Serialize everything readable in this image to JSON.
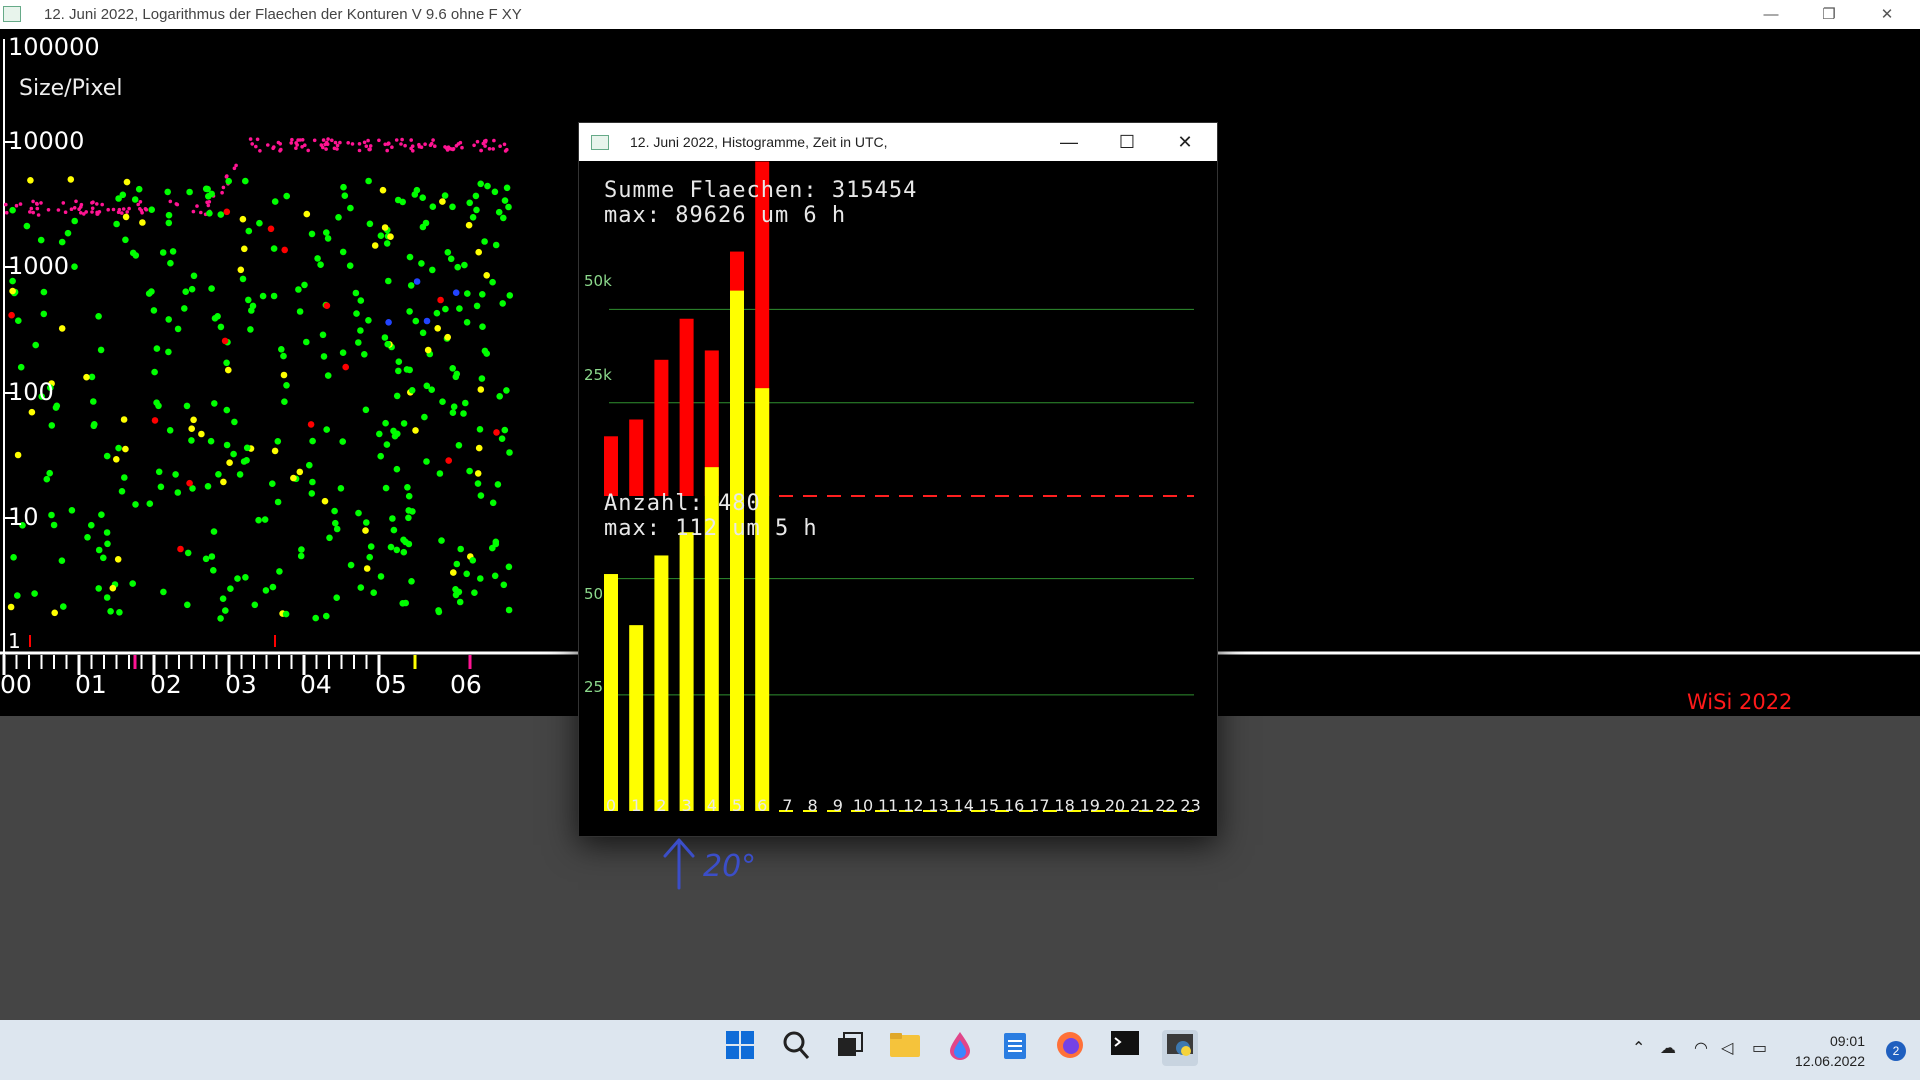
{
  "main_window": {
    "title": "12. Juni 2022, Logarithmus der Flaechen der Konturen  V 9.6 ohne F XY",
    "controls": [
      "—",
      "❐",
      "✕"
    ]
  },
  "scatter_plot": {
    "y_axis_labels": [
      "100000",
      "10000",
      "1000",
      "100",
      "10",
      "1"
    ],
    "y_axis_title": "Size/Pixel",
    "x_hour_labels": [
      "00",
      "01",
      "02",
      "03",
      "04",
      "05",
      "06"
    ],
    "credit": "WiSi 2022",
    "colors": {
      "green": "#00ff00",
      "yellow": "#ffff00",
      "red": "#ff0000",
      "magenta": "#ff1493",
      "blue": "#2244ff"
    }
  },
  "histogram_window": {
    "title": "12. Juni 2022, Histogramme, Zeit in UTC,",
    "controls": [
      "—",
      "☐",
      "✕"
    ],
    "area_sum_line": "Summe Flaechen: 315454",
    "area_max_line": "max: 89626 um 6 h",
    "count_line": "Anzahl: 480",
    "count_max_line": "max: 112 um 5 h",
    "grid_labels_area": [
      "50k",
      "25k"
    ],
    "grid_labels_count": [
      "50",
      "25"
    ],
    "hours": [
      "0",
      "1",
      "2",
      "3",
      "4",
      "5",
      "6",
      "7",
      "8",
      "9",
      "10",
      "11",
      "12",
      "13",
      "14",
      "15",
      "16",
      "17",
      "18",
      "19",
      "20",
      "21",
      "22",
      "23"
    ]
  },
  "chart_data": [
    {
      "type": "bar",
      "title": "Summe Flaechen: 315454",
      "categories": [
        "0",
        "1",
        "2",
        "3",
        "4",
        "5",
        "6",
        "7",
        "8",
        "9",
        "10",
        "11",
        "12",
        "13",
        "14",
        "15",
        "16",
        "17",
        "18",
        "19",
        "20",
        "21",
        "22",
        "23"
      ],
      "values": [
        16000,
        20500,
        36500,
        47500,
        39000,
        65500,
        89626,
        0,
        0,
        0,
        0,
        0,
        0,
        0,
        0,
        0,
        0,
        0,
        0,
        0,
        0,
        0,
        0,
        0
      ],
      "ylim": [
        0,
        82000
      ],
      "color": "#ff0000"
    },
    {
      "type": "bar",
      "title": "Anzahl: 480",
      "categories": [
        "0",
        "1",
        "2",
        "3",
        "4",
        "5",
        "6",
        "7",
        "8",
        "9",
        "10",
        "11",
        "12",
        "13",
        "14",
        "15",
        "16",
        "17",
        "18",
        "19",
        "20",
        "21",
        "22",
        "23"
      ],
      "values": [
        51,
        40,
        55,
        60,
        74,
        112,
        91,
        0,
        0,
        0,
        0,
        0,
        0,
        0,
        0,
        0,
        0,
        0,
        0,
        0,
        0,
        0,
        0,
        0
      ],
      "ylim": [
        0,
        82
      ],
      "color": "#ffff00"
    }
  ],
  "annotation": {
    "text": "20°"
  },
  "taskbar": {
    "icons": [
      "windows-start-icon",
      "search-icon",
      "task-view-icon",
      "file-explorer-icon",
      "paint-icon",
      "notepad-icon",
      "firefox-icon",
      "terminal-icon",
      "python-app-icon"
    ],
    "time": "09:01",
    "date": "12.06.2022",
    "notification_count": "2"
  }
}
